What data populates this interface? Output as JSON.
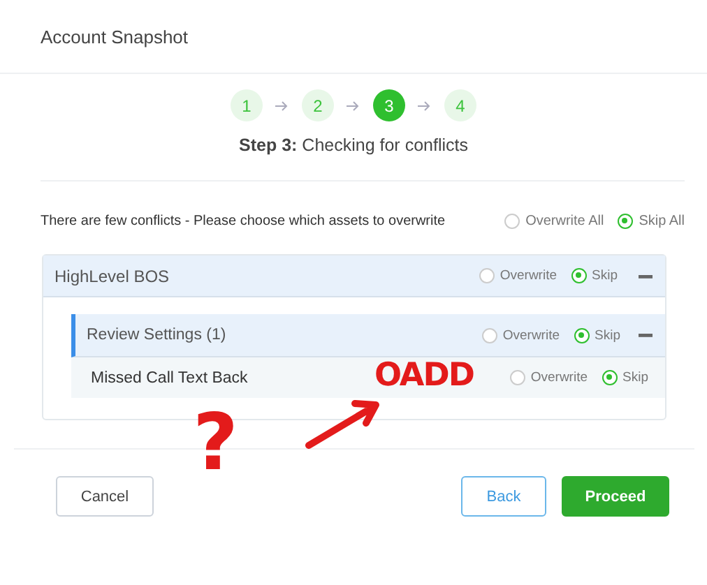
{
  "header": {
    "title": "Account Snapshot"
  },
  "steps": [
    {
      "label": "1",
      "selected": false
    },
    {
      "label": "2",
      "selected": false
    },
    {
      "label": "3",
      "selected": true
    },
    {
      "label": "4",
      "selected": false
    }
  ],
  "step_caption": "**Step 3:** Checking for conflicts",
  "conflicts": {
    "message": "There are few conflicts - Please choose which assets to overwrite",
    "options": [
      {
        "label": "Overwrite All",
        "selected": false
      },
      {
        "label": "Skip All",
        "selected": true
      }
    ]
  },
  "groups": [
    {
      "name": "HighLevel BOS",
      "expanded": true,
      "options": [
        {
          "label": "Overwrite",
          "selected": false
        },
        {
          "label": "Skip",
          "selected": true
        }
      ],
      "children": [
        {
          "name": "Review Settings (1)",
          "expanded": true,
          "options": [
            {
              "label": "Overwrite",
              "selected": false
            },
            {
              "label": "Skip",
              "selected": true
            }
          ],
          "children": [
            {
              "name": "Missed Call Text Back",
              "options": [
                {
                  "label": "Overwrite",
                  "selected": false
                },
                {
                  "label": "Skip",
                  "selected": true
                }
              ]
            }
          ]
        }
      ]
    }
  ],
  "buttons": [
    {
      "label": "Cancel",
      "kind": "cancel"
    },
    {
      "label": "Back",
      "kind": "secondary"
    },
    {
      "label": "Proceed",
      "kind": "primary"
    }
  ],
  "annotations": [
    {
      "kind": "text",
      "text": "OADD"
    },
    {
      "kind": "arrow"
    },
    {
      "kind": "text",
      "text": "?"
    }
  ]
}
